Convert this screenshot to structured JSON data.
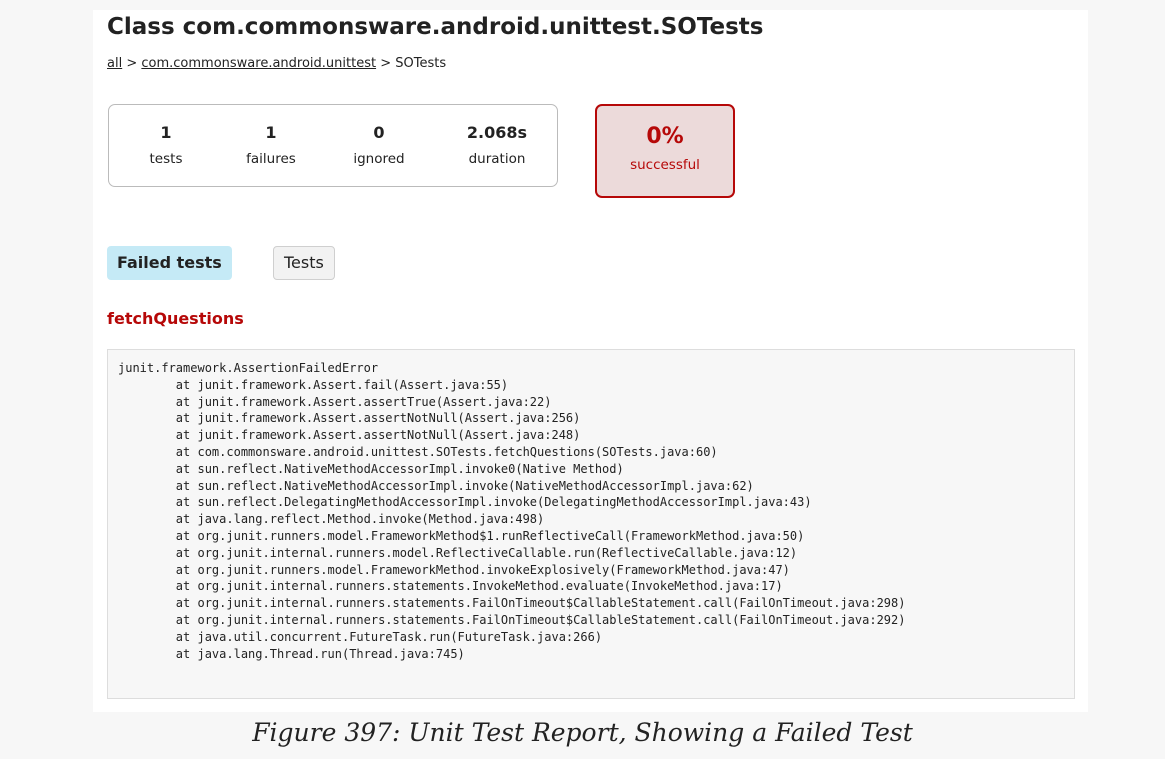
{
  "page": {
    "title": "Class com.commonsware.android.unittest.SOTests"
  },
  "breadcrumb": {
    "all_link": "all",
    "separator_1": " > ",
    "package_link": "com.commonsware.android.unittest",
    "separator_2": " > ",
    "current": "SOTests"
  },
  "summary": {
    "tests": {
      "value": "1",
      "label": "tests"
    },
    "failures": {
      "value": "1",
      "label": "failures"
    },
    "ignored": {
      "value": "0",
      "label": "ignored"
    },
    "duration": {
      "value": "2.068s",
      "label": "duration"
    },
    "success": {
      "value": "0%",
      "label": "successful",
      "color": "#b60808",
      "background": "#ecdada"
    }
  },
  "tabs": [
    {
      "label": "Failed tests",
      "selected": true
    },
    {
      "label": "Tests",
      "selected": false
    }
  ],
  "failed_test": {
    "name": "fetchQuestions",
    "stacktrace": "junit.framework.AssertionFailedError\n\tat junit.framework.Assert.fail(Assert.java:55)\n\tat junit.framework.Assert.assertTrue(Assert.java:22)\n\tat junit.framework.Assert.assertNotNull(Assert.java:256)\n\tat junit.framework.Assert.assertNotNull(Assert.java:248)\n\tat com.commonsware.android.unittest.SOTests.fetchQuestions(SOTests.java:60)\n\tat sun.reflect.NativeMethodAccessorImpl.invoke0(Native Method)\n\tat sun.reflect.NativeMethodAccessorImpl.invoke(NativeMethodAccessorImpl.java:62)\n\tat sun.reflect.DelegatingMethodAccessorImpl.invoke(DelegatingMethodAccessorImpl.java:43)\n\tat java.lang.reflect.Method.invoke(Method.java:498)\n\tat org.junit.runners.model.FrameworkMethod$1.runReflectiveCall(FrameworkMethod.java:50)\n\tat org.junit.internal.runners.model.ReflectiveCallable.run(ReflectiveCallable.java:12)\n\tat org.junit.runners.model.FrameworkMethod.invokeExplosively(FrameworkMethod.java:47)\n\tat org.junit.internal.runners.statements.InvokeMethod.evaluate(InvokeMethod.java:17)\n\tat org.junit.internal.runners.statements.FailOnTimeout$CallableStatement.call(FailOnTimeout.java:298)\n\tat org.junit.internal.runners.statements.FailOnTimeout$CallableStatement.call(FailOnTimeout.java:292)\n\tat java.util.concurrent.FutureTask.run(FutureTask.java:266)\n\tat java.lang.Thread.run(Thread.java:745)"
  },
  "caption": "Figure 397: Unit Test Report, Showing a Failed Test",
  "colors": {
    "failure_red": "#b60808",
    "selected_tab": "#c5eaf6"
  }
}
